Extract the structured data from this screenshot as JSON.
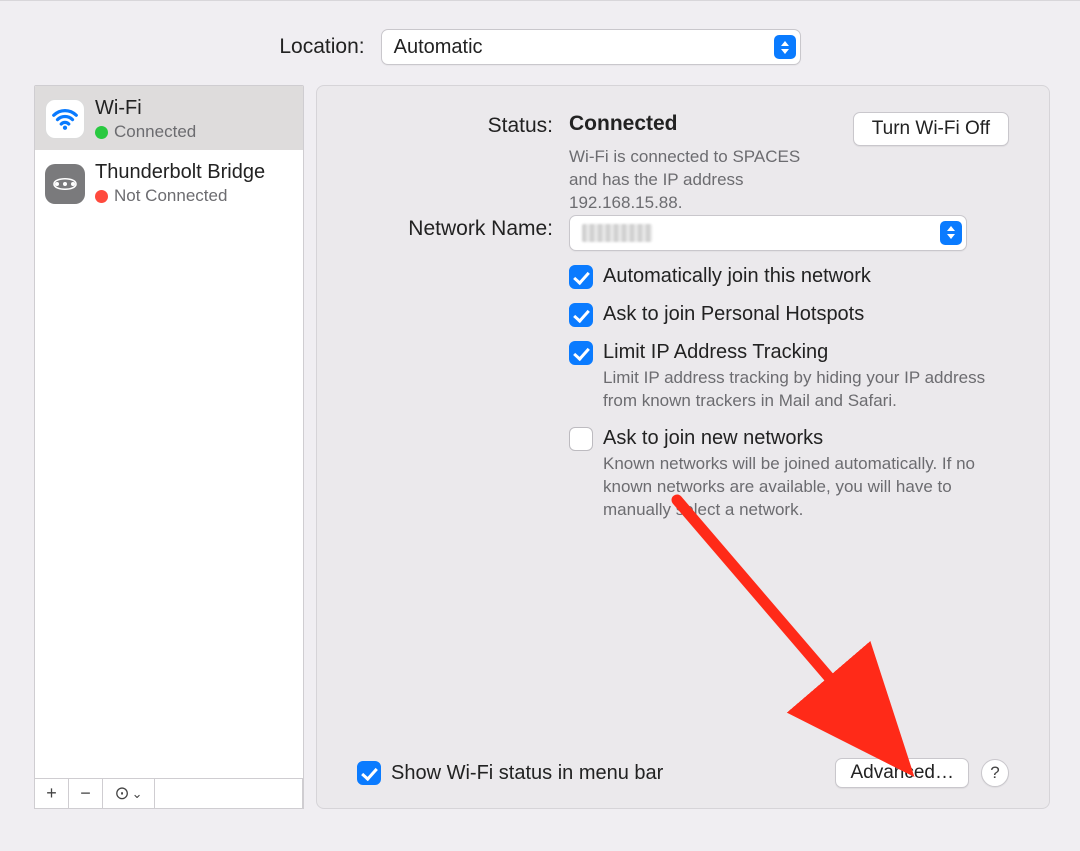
{
  "location": {
    "label": "Location:",
    "value": "Automatic"
  },
  "sidebar": {
    "services": [
      {
        "name": "Wi-Fi",
        "status": "Connected",
        "dot": "green",
        "selected": true,
        "icon": "wifi"
      },
      {
        "name": "Thunderbolt Bridge",
        "status": "Not Connected",
        "dot": "red",
        "selected": false,
        "icon": "tb"
      }
    ],
    "actions": {
      "add": "+",
      "remove": "−",
      "more": "⊙",
      "more_chevron": "⌄"
    }
  },
  "panel": {
    "status_label": "Status:",
    "status_value": "Connected",
    "status_desc": "Wi-Fi is connected to SPACES and has the IP address 192.168.15.88.",
    "wifi_toggle": "Turn Wi-Fi Off",
    "network_label": "Network Name:",
    "network_name": "(redacted)",
    "opts": {
      "auto_join": {
        "label": "Automatically join this network",
        "checked": true
      },
      "ask_hotspot": {
        "label": "Ask to join Personal Hotspots",
        "checked": true
      },
      "limit_ip": {
        "label": "Limit IP Address Tracking",
        "checked": true,
        "desc": "Limit IP address tracking by hiding your IP address from known trackers in Mail and Safari."
      },
      "ask_new": {
        "label": "Ask to join new networks",
        "checked": false,
        "desc": "Known networks will be joined automatically. If no known networks are available, you will have to manually select a network."
      }
    },
    "show_menu": {
      "label": "Show Wi-Fi status in menu bar",
      "checked": true
    },
    "advanced": "Advanced…",
    "help": "?"
  }
}
